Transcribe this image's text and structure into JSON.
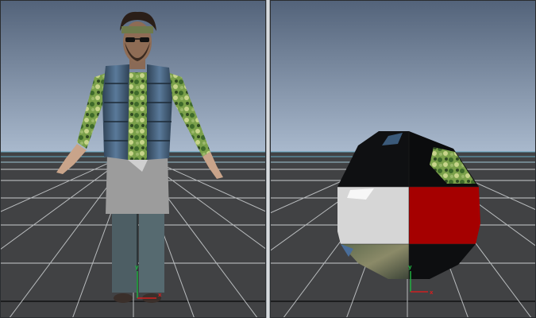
{
  "viewports": {
    "left": {
      "name": "character-view",
      "axis": {
        "x_label": "x",
        "y_label": "y"
      }
    },
    "right": {
      "name": "uv-sphere-view",
      "axis": {
        "x_label": "x",
        "y_label": "y"
      }
    }
  },
  "colors": {
    "sky_top": "#53637a",
    "sky_bottom": "#a9b9cd",
    "ground": "#414244",
    "grid_line": "#c9ccce",
    "grid_horizon": "#63a9c2",
    "axis_x": "#d02020",
    "axis_y": "#20b040",
    "axis_z": "#2040d0",
    "red_face": "#a50000",
    "white_face": "#d6d6d6"
  }
}
